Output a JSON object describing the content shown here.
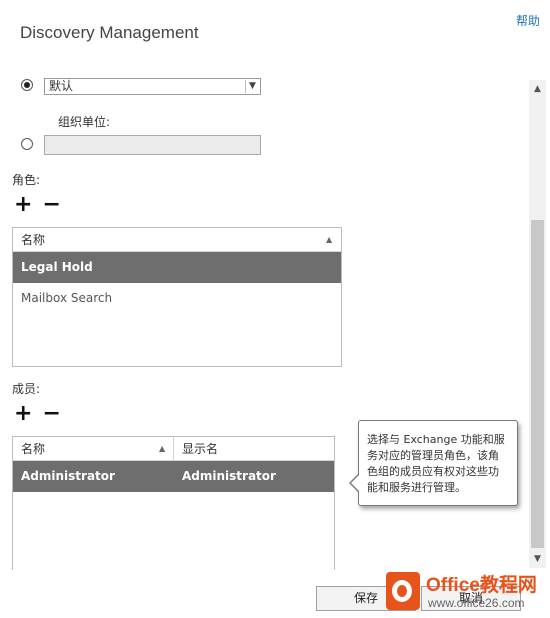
{
  "header": {
    "title": "Discovery Management",
    "help_link": "帮助"
  },
  "scope": {
    "default_option_selected": true,
    "default_select_value": "默认",
    "ou_option_selected": false,
    "ou_label": "组织单位:",
    "ou_value": ""
  },
  "roles": {
    "label": "角色:",
    "add_symbol": "+",
    "remove_symbol": "−",
    "column_header": "名称",
    "items": [
      {
        "name": "Legal Hold",
        "selected": true
      },
      {
        "name": "Mailbox Search",
        "selected": false
      }
    ]
  },
  "members": {
    "label": "成员:",
    "add_symbol": "+",
    "remove_symbol": "−",
    "col_name": "名称",
    "col_display": "显示名",
    "items": [
      {
        "name": "Administrator",
        "display_name": "Administrator",
        "selected": true
      }
    ]
  },
  "callout": {
    "line1": "选择与 Exchange 功能和服",
    "line2": "务对应的管理员角色，该角",
    "line3": "色组的成员应有权对这些功",
    "line4": "能和服务进行管理。"
  },
  "footer": {
    "save_label": "保存",
    "cancel_label": "取消"
  },
  "watermark": {
    "brand": "Office教程网",
    "url": "www.office26.com"
  },
  "colors": {
    "link": "#1e73be",
    "selected_row": "#6e6e6e",
    "brand": "#e8521b"
  }
}
